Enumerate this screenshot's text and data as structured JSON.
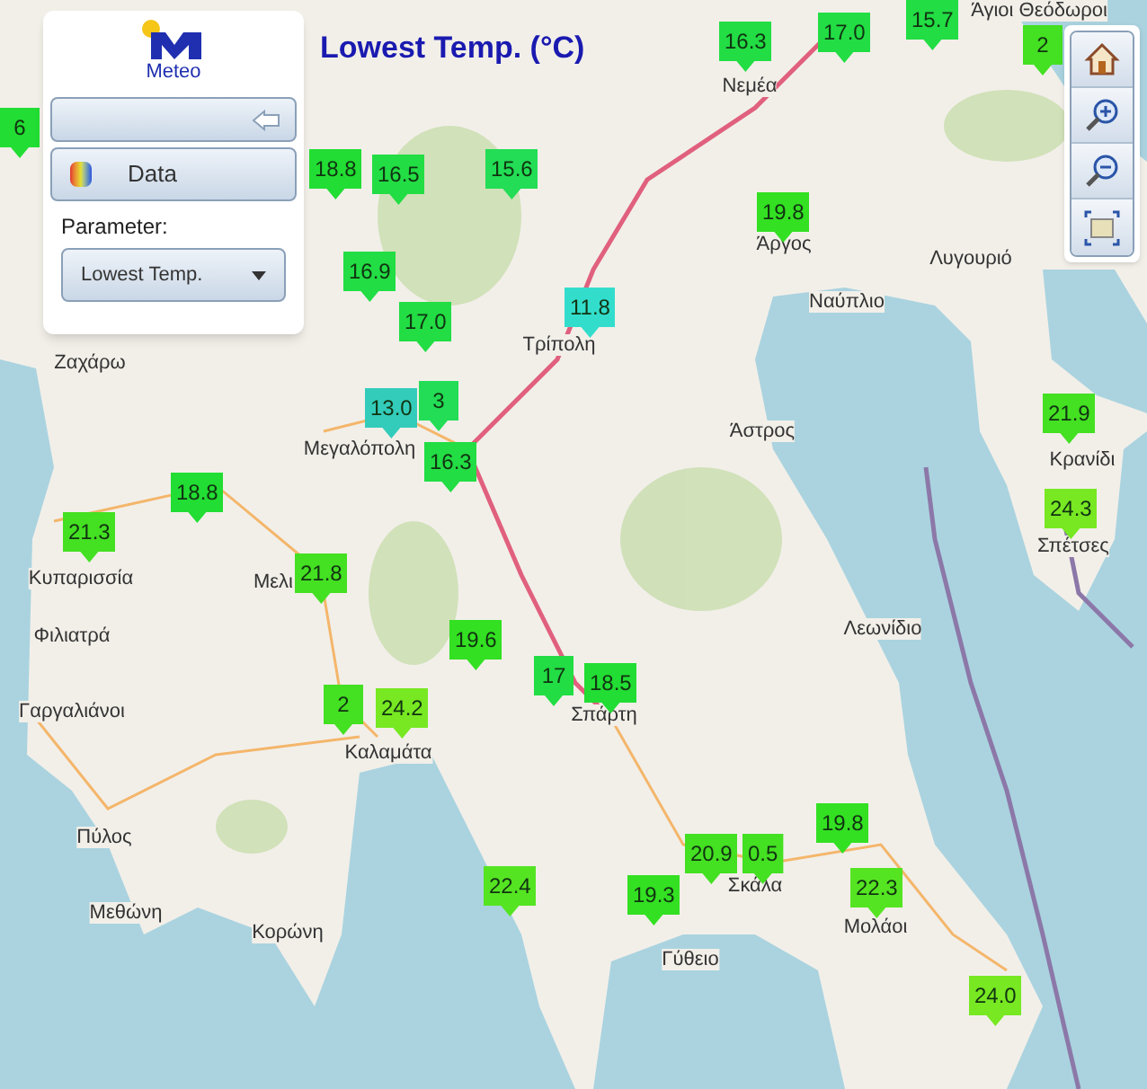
{
  "title": "Lowest Temp. (°C)",
  "panel": {
    "logo_text": "Meteo",
    "data_button": "Data",
    "parameter_label": "Parameter:",
    "parameter_select": "Lowest Temp."
  },
  "toolbar": [
    {
      "kind": "home"
    },
    {
      "kind": "zoom_in"
    },
    {
      "kind": "zoom_out"
    },
    {
      "kind": "full_extent"
    }
  ],
  "places": [
    "Άγιοι Θεόδωροι",
    "Νεμέα",
    "Άργος",
    "Λυγουριό",
    "Ναύπλιο",
    "Τρίπολη",
    "Ζαχάρω",
    "Μεγαλόπολη",
    "Άστρος",
    "Κρανίδι",
    "Σπέτσες",
    "Κυπαρισσία",
    "Μελι",
    "Φιλιατρά",
    "Λεωνίδιο",
    "Γαργαλιάνοι",
    "Σπάρτη",
    "Καλαμάτα",
    "Πύλος",
    "Μεθώνη",
    "Κορώνη",
    "Σκάλα",
    "Μολάοι",
    "Γύθειο"
  ],
  "markers": [
    {
      "value": "6",
      "color": "#22dd33"
    },
    {
      "value": "16.3",
      "color": "#22dd44"
    },
    {
      "value": "17.0",
      "color": "#22dd44"
    },
    {
      "value": "15.7",
      "color": "#22dd44"
    },
    {
      "value": "2",
      "color": "#44e022"
    },
    {
      "value": "18.8",
      "color": "#22dd33"
    },
    {
      "value": "16.5",
      "color": "#22dd44"
    },
    {
      "value": "15.6",
      "color": "#22dd55"
    },
    {
      "value": "19.8",
      "color": "#33e022"
    },
    {
      "value": "16.9",
      "color": "#22dd44"
    },
    {
      "value": "17.0",
      "color": "#22dd44"
    },
    {
      "value": "11.8",
      "color": "#33ddcc"
    },
    {
      "value": "13.0",
      "color": "#33ccbb"
    },
    {
      "value": "3",
      "color": "#22dd55"
    },
    {
      "value": "16.3",
      "color": "#22dd44"
    },
    {
      "value": "18.8",
      "color": "#22dd33"
    },
    {
      "value": "21.3",
      "color": "#44e022"
    },
    {
      "value": "21.8",
      "color": "#44e022"
    },
    {
      "value": "19.6",
      "color": "#33e022"
    },
    {
      "value": "17",
      "color": "#22dd44"
    },
    {
      "value": "18.5",
      "color": "#22dd33"
    },
    {
      "value": "2",
      "color": "#44e022"
    },
    {
      "value": "24.2",
      "color": "#77e822"
    },
    {
      "value": "21.9",
      "color": "#44e022"
    },
    {
      "value": "24.3",
      "color": "#77e822"
    },
    {
      "value": "22.4",
      "color": "#55e422"
    },
    {
      "value": "19.3",
      "color": "#33e022"
    },
    {
      "value": "20.9",
      "color": "#44e022"
    },
    {
      "value": "0.5",
      "color": "#44e022"
    },
    {
      "value": "19.8",
      "color": "#33e022"
    },
    {
      "value": "22.3",
      "color": "#55e422"
    },
    {
      "value": "24.0",
      "color": "#77e822"
    }
  ]
}
